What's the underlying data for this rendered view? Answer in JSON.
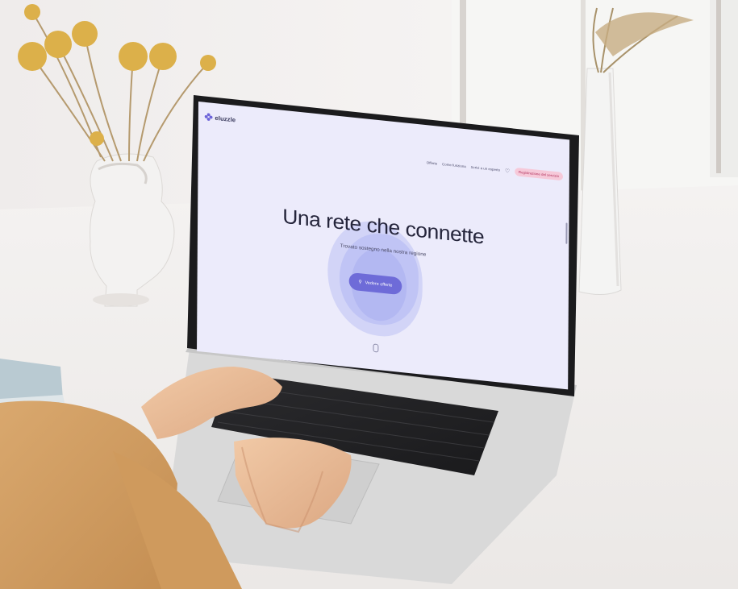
{
  "screen": {
    "logo": {
      "name": "eluzzle",
      "tagline": ""
    },
    "nav": {
      "items": [
        "Offerte",
        "Come funziona",
        "Scrivi a un esperto"
      ],
      "heart_icon": "heart-icon",
      "cta_label": "Registrazione del servizio"
    },
    "hero": {
      "title": "Una rete che connette",
      "subtitle": "Trovato sostegno nella nostra regione",
      "button_label": "Vedere offerte",
      "button_icon": "search-icon"
    },
    "scroll_icon": "scroll-down-icon"
  },
  "colors": {
    "screen_bg": "#ecebfb",
    "accent": "#6e6bd8",
    "cta_bg": "#f6c9d9",
    "blob": "#b8bdf3"
  }
}
